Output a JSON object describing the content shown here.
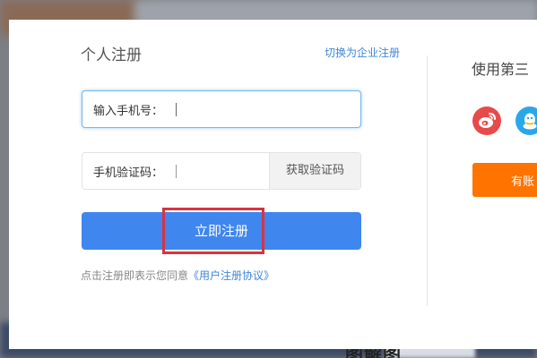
{
  "dialog": {
    "title": "个人注册",
    "switch_link": "切换为企业注册",
    "phone": {
      "label": "输入手机号："
    },
    "code": {
      "label": "手机验证码：",
      "button": "获取验证码"
    },
    "register_button": "立即注册",
    "agreement": {
      "prefix": "点击注册即表示您同意",
      "link": "《用户注册协议》"
    }
  },
  "third_party": {
    "title": "使用第三",
    "has_account": "有账"
  },
  "background": {
    "text": "图解图"
  },
  "colors": {
    "primary_blue": "#3f86ef",
    "link_blue": "#3f86d8",
    "orange": "#ff7300",
    "weibo_red": "#e84a4a",
    "qq_blue": "#28a8e8",
    "highlight_red": "#d9333d"
  }
}
